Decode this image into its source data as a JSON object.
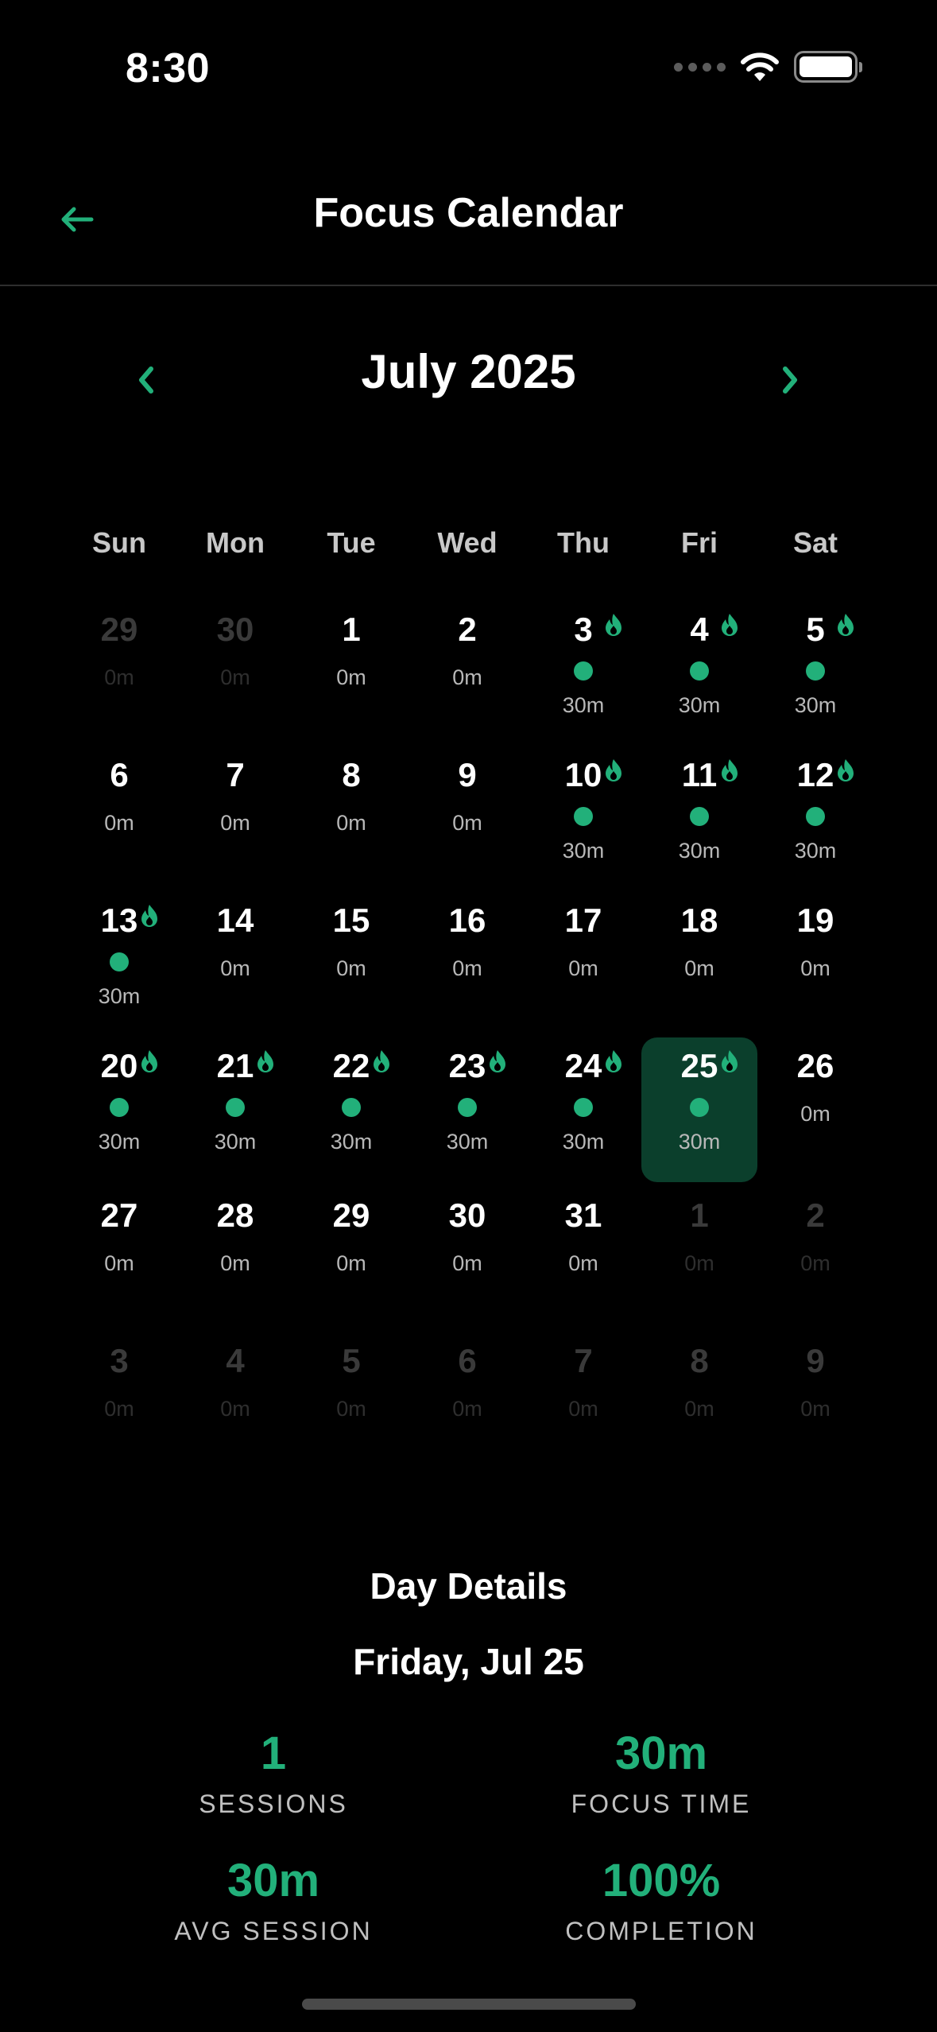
{
  "status_bar": {
    "time": "8:30"
  },
  "header": {
    "title": "Focus Calendar",
    "back_icon": "arrow-left-icon"
  },
  "calendar": {
    "month_title": "July 2025",
    "weekdays": [
      "Sun",
      "Mon",
      "Tue",
      "Wed",
      "Thu",
      "Fri",
      "Sat"
    ],
    "accent_color": "#22b07a",
    "selected_color": "#0b3f2c",
    "weeks": [
      [
        {
          "day": "29",
          "minutes": "0m",
          "outside": true,
          "active": false
        },
        {
          "day": "30",
          "minutes": "0m",
          "outside": true,
          "active": false
        },
        {
          "day": "1",
          "minutes": "0m",
          "outside": false,
          "active": false
        },
        {
          "day": "2",
          "minutes": "0m",
          "outside": false,
          "active": false
        },
        {
          "day": "3",
          "minutes": "30m",
          "outside": false,
          "active": true
        },
        {
          "day": "4",
          "minutes": "30m",
          "outside": false,
          "active": true
        },
        {
          "day": "5",
          "minutes": "30m",
          "outside": false,
          "active": true
        }
      ],
      [
        {
          "day": "6",
          "minutes": "0m",
          "outside": false,
          "active": false
        },
        {
          "day": "7",
          "minutes": "0m",
          "outside": false,
          "active": false
        },
        {
          "day": "8",
          "minutes": "0m",
          "outside": false,
          "active": false
        },
        {
          "day": "9",
          "minutes": "0m",
          "outside": false,
          "active": false
        },
        {
          "day": "10",
          "minutes": "30m",
          "outside": false,
          "active": true
        },
        {
          "day": "11",
          "minutes": "30m",
          "outside": false,
          "active": true
        },
        {
          "day": "12",
          "minutes": "30m",
          "outside": false,
          "active": true
        }
      ],
      [
        {
          "day": "13",
          "minutes": "30m",
          "outside": false,
          "active": true
        },
        {
          "day": "14",
          "minutes": "0m",
          "outside": false,
          "active": false
        },
        {
          "day": "15",
          "minutes": "0m",
          "outside": false,
          "active": false
        },
        {
          "day": "16",
          "minutes": "0m",
          "outside": false,
          "active": false
        },
        {
          "day": "17",
          "minutes": "0m",
          "outside": false,
          "active": false
        },
        {
          "day": "18",
          "minutes": "0m",
          "outside": false,
          "active": false
        },
        {
          "day": "19",
          "minutes": "0m",
          "outside": false,
          "active": false
        }
      ],
      [
        {
          "day": "20",
          "minutes": "30m",
          "outside": false,
          "active": true
        },
        {
          "day": "21",
          "minutes": "30m",
          "outside": false,
          "active": true
        },
        {
          "day": "22",
          "minutes": "30m",
          "outside": false,
          "active": true
        },
        {
          "day": "23",
          "minutes": "30m",
          "outside": false,
          "active": true
        },
        {
          "day": "24",
          "minutes": "30m",
          "outside": false,
          "active": true
        },
        {
          "day": "25",
          "minutes": "30m",
          "outside": false,
          "active": true,
          "selected": true
        },
        {
          "day": "26",
          "minutes": "0m",
          "outside": false,
          "active": false
        }
      ],
      [
        {
          "day": "27",
          "minutes": "0m",
          "outside": false,
          "active": false
        },
        {
          "day": "28",
          "minutes": "0m",
          "outside": false,
          "active": false
        },
        {
          "day": "29",
          "minutes": "0m",
          "outside": false,
          "active": false
        },
        {
          "day": "30",
          "minutes": "0m",
          "outside": false,
          "active": false
        },
        {
          "day": "31",
          "minutes": "0m",
          "outside": false,
          "active": false
        },
        {
          "day": "1",
          "minutes": "0m",
          "outside": true,
          "active": false
        },
        {
          "day": "2",
          "minutes": "0m",
          "outside": true,
          "active": false
        }
      ],
      [
        {
          "day": "3",
          "minutes": "0m",
          "outside": true,
          "active": false
        },
        {
          "day": "4",
          "minutes": "0m",
          "outside": true,
          "active": false
        },
        {
          "day": "5",
          "minutes": "0m",
          "outside": true,
          "active": false
        },
        {
          "day": "6",
          "minutes": "0m",
          "outside": true,
          "active": false
        },
        {
          "day": "7",
          "minutes": "0m",
          "outside": true,
          "active": false
        },
        {
          "day": "8",
          "minutes": "0m",
          "outside": true,
          "active": false
        },
        {
          "day": "9",
          "minutes": "0m",
          "outside": true,
          "active": false
        }
      ]
    ]
  },
  "details": {
    "title": "Day Details",
    "date": "Friday, Jul 25",
    "stats": [
      {
        "value": "1",
        "label": "SESSIONS"
      },
      {
        "value": "30m",
        "label": "FOCUS TIME"
      },
      {
        "value": "30m",
        "label": "AVG SESSION"
      },
      {
        "value": "100%",
        "label": "COMPLETION"
      }
    ]
  }
}
